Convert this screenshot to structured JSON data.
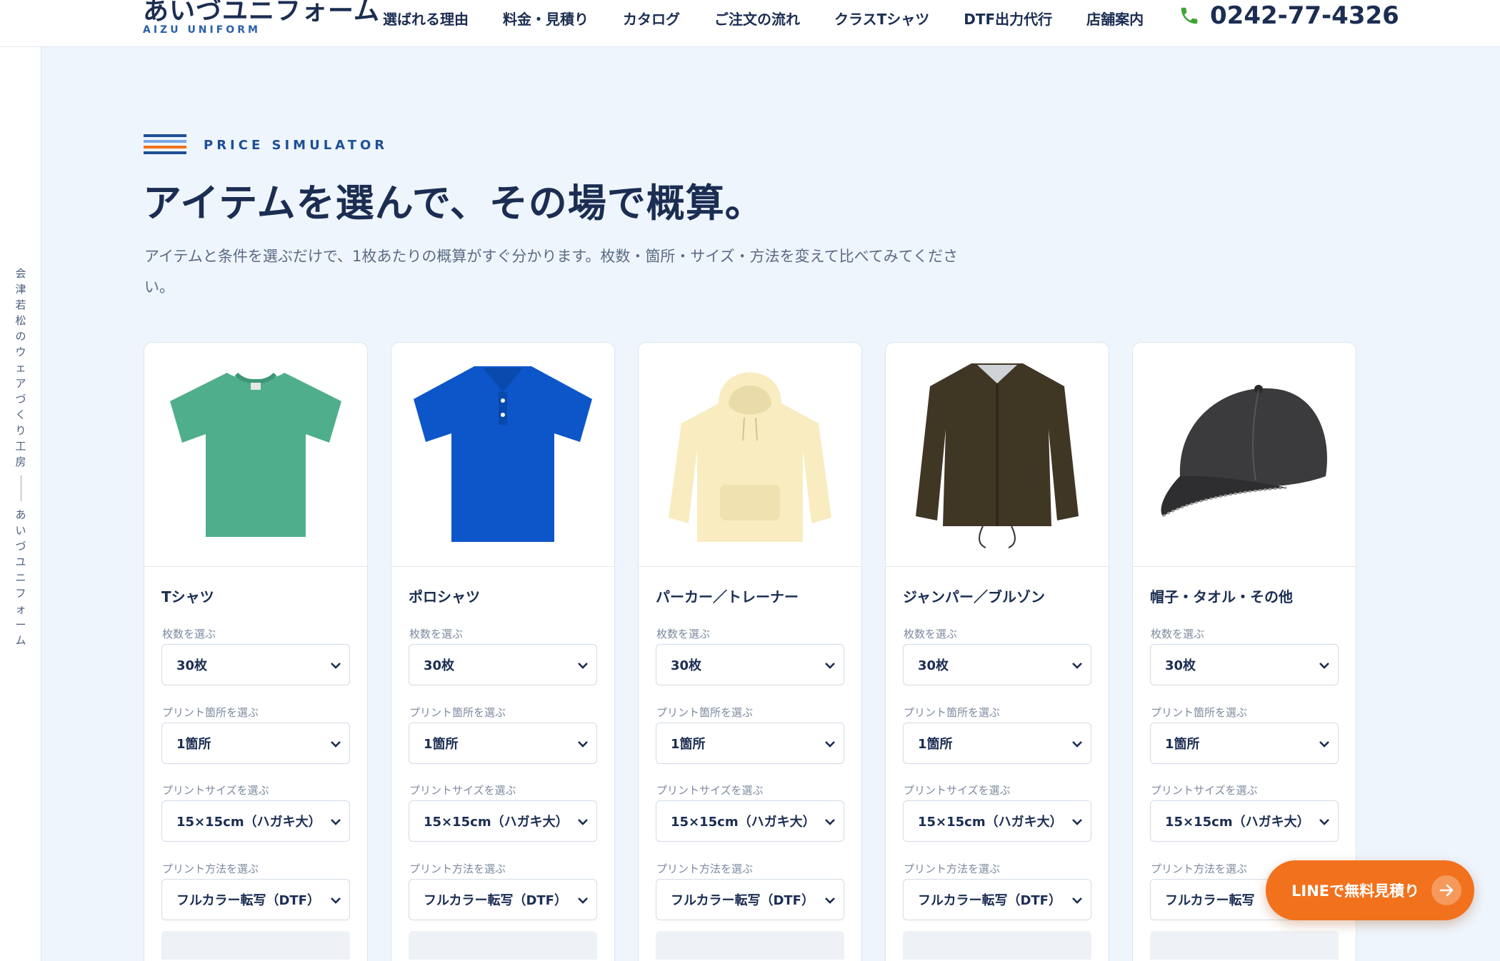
{
  "header": {
    "logo_jp": "あいづユニフォーム",
    "logo_en": "AIZU UNIFORM",
    "nav": [
      "選ばれる理由",
      "料金・見積り",
      "カタログ",
      "ご注文の流れ",
      "クラスTシャツ",
      "DTF出力代行",
      "店舗案内"
    ],
    "phone": "0242-77-4326"
  },
  "side": {
    "tagline": "会津若松のウェアづくり工房",
    "brand": "あいづユニフォーム"
  },
  "section": {
    "eyebrow": "PRICE SIMULATOR",
    "title": "アイテムを選んで、その場で概算。",
    "lead": "アイテムと条件を選ぶだけで、1枚あたりの概算がすぐ分かります。枚数・箇所・サイズ・方法を変えて比べてみてください。"
  },
  "labels": {
    "quantity": "枚数を選ぶ",
    "location": "プリント箇所を選ぶ",
    "size": "プリントサイズを選ぶ",
    "method": "プリント方法を選ぶ"
  },
  "cards": [
    {
      "title": "Tシャツ",
      "icon": "tshirt-image",
      "color": "#4fae8b",
      "quantity": "30枚",
      "location": "1箇所",
      "size": "15×15cm（ハガキ大）",
      "method": "フルカラー転写（DTF）"
    },
    {
      "title": "ポロシャツ",
      "icon": "polo-shirt-image",
      "color": "#0d56c9",
      "quantity": "30枚",
      "location": "1箇所",
      "size": "15×15cm（ハガキ大）",
      "method": "フルカラー転写（DTF）"
    },
    {
      "title": "パーカー／トレーナー",
      "icon": "hoodie-image",
      "color": "#f8ecc0",
      "quantity": "30枚",
      "location": "1箇所",
      "size": "15×15cm（ハガキ大）",
      "method": "フルカラー転写（DTF）"
    },
    {
      "title": "ジャンパー／ブルゾン",
      "icon": "jacket-image",
      "color": "#3f3624",
      "quantity": "30枚",
      "location": "1箇所",
      "size": "15×15cm（ハガキ大）",
      "method": "フルカラー転写（DTF）"
    },
    {
      "title": "帽子・タオル・その他",
      "icon": "cap-image",
      "color": "#3b3b3d",
      "quantity": "30枚",
      "location": "1箇所",
      "size": "15×15cm（ハガキ大）",
      "method": "フルカラー転写"
    }
  ],
  "line_cta": {
    "label": "LINEで無料見積り",
    "color": "#f2711c"
  },
  "colors": {
    "navy": "#1b2d52",
    "accent_blue": "#2a5fa8",
    "accent_orange": "#f2711c",
    "phone_green": "#3fa535",
    "background": "#eef5fc"
  }
}
